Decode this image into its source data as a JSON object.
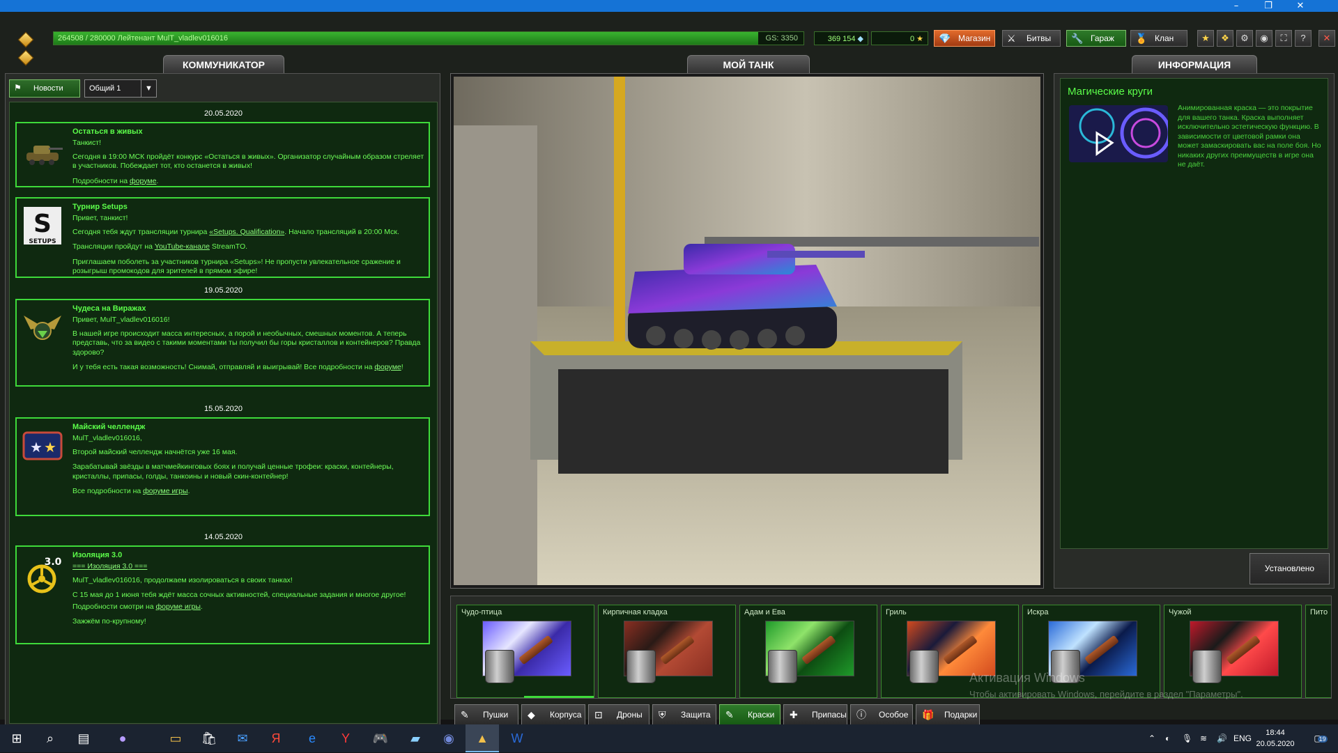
{
  "window": {
    "minimize_icon": "minimize-icon",
    "maximize_icon": "restore-icon",
    "close_icon": "close-icon"
  },
  "topbar": {
    "xp_text": "264508 / 280000  Лейтенант MulT_vladlev016016",
    "xp_progress": 0.94,
    "gs_text": "GS: 3350",
    "crystals": "369 154",
    "stars": "0",
    "buttons": {
      "shop": "Магазин",
      "battles": "Битвы",
      "garage": "Гараж",
      "clan": "Клан"
    },
    "icons": [
      "star-icon",
      "medal-icon",
      "gear-icon",
      "sound-icon",
      "fullscreen-icon",
      "help-icon",
      "exit-icon"
    ]
  },
  "panels": {
    "communicator": "КОММУНИКАТОР",
    "mytank": "МОЙ ТАНК",
    "info": "ИНФОРМАЦИЯ"
  },
  "communicator": {
    "news_button": "Новости",
    "channel": "Общий 1",
    "feed": [
      {
        "date": "20.05.2020"
      },
      {
        "title": "Остаться в живых",
        "lines": [
          "Танкист!",
          "Сегодня в 19:00 МСК пройдёт конкурс «Остаться в живых». Организатор случайным образом стреляет в участников. Побеждает тот, кто останется в живых!"
        ],
        "link_prefix": "Подробности на ",
        "link": "форуме",
        "link_suffix": "."
      },
      {
        "title": "Турнир  Setups",
        "lines": [
          "Привет, танкист!"
        ],
        "p2_prefix": "Сегодня тебя ждут трансляции турнира ",
        "p2_link": "«Setups. Qualification»",
        "p2_suffix": ".  Начало трансляций в 20:00 Мск.",
        "p3_prefix": "Трансляции пройдут на ",
        "p3_link": "YouTube-канале",
        "p3_suffix": "  StreamTO.",
        "p4": "Приглашаем поболеть за участников турнира «Setups»! Не пропусти увлекательное сражение и розыгрыш промокодов для зрителей в прямом эфире!"
      },
      {
        "date": "19.05.2020"
      },
      {
        "title": "Чудеса на Виражах",
        "lines": [
          "Привет, MulT_vladlev016016!",
          "В нашей игре происходит масса интересных, а порой и необычных, смешных моментов. А теперь представь, что за видео с такими моментами ты получил бы горы кристаллов и контейнеров? Правда здорово?"
        ],
        "link_prefix": " И у тебя есть такая возможность! Снимай, отправляй и выигрывай! Все подробности на ",
        "link": "форуме",
        "link_suffix": "!"
      },
      {
        "date": "15.05.2020"
      },
      {
        "title": " Майский челлендж",
        "lines": [
          "MulT_vladlev016016,",
          "Второй майский челлендж начнётся уже 16 мая.",
          "Зарабатывай звёзды в матчмейкинговых боях и получай ценные трофеи: краски, контейнеры, кристаллы, припасы, голды, танкоины и новый скин-контейнер!"
        ],
        "link_prefix": "Все подробности на ",
        "link": "форуме игры",
        "link_suffix": "."
      },
      {
        "date": "14.05.2020"
      },
      {
        "title": "Изоляция 3.0",
        "subtitle_link": "=== Изоляция 3.0 ===",
        "lines": [
          "MulT_vladlev016016, продолжаем изолироваться в своих танках!",
          "С 15 мая до 1 июня тебя ждёт масса сочных активностей, специальные задания и многое другое!"
        ],
        "link_prefix": "Подробности смотри на ",
        "link": "форуме игры",
        "link_suffix": ".",
        "outro": "Зажжём по-крупному!"
      }
    ]
  },
  "info": {
    "title": "Магические круги",
    "description": "Анимированная краска — это покрытие для вашего танка. Краска выполняет исключительно эстетическую функцию. В зависимости от цветовой рамки она может замаскировать вас на поле боя. Но никаких других преимуществ в игре она не даёт.",
    "installed_button": "Установлено"
  },
  "items": [
    {
      "name": "Чудо-птица",
      "colors": [
        "#6a5cff",
        "#e6e6ff",
        "#3a2aa8"
      ]
    },
    {
      "name": "Кирпичная кладка",
      "colors": [
        "#8a2f22",
        "#2a1a16",
        "#b34a34"
      ]
    },
    {
      "name": "Адам и Ева",
      "colors": [
        "#1f9a2a",
        "#8fe36a",
        "#0d4d12"
      ]
    },
    {
      "name": "Гриль",
      "colors": [
        "#d24a1e",
        "#1a1a3a",
        "#ff8a3a"
      ]
    },
    {
      "name": "Искра",
      "colors": [
        "#2a6ad8",
        "#bfe2ff",
        "#0a1a4a"
      ]
    },
    {
      "name": "Чужой",
      "colors": [
        "#c0192a",
        "#1a1a1a",
        "#ff4a4a"
      ]
    },
    {
      "name": "Пито"
    }
  ],
  "categories": [
    "Пушки",
    "Корпуса",
    "Дроны",
    "Защита",
    "Краски",
    "Припасы",
    "Особое",
    "Подарки"
  ],
  "active_category": "Краски",
  "watermark": {
    "line1": "Активация Windows",
    "line2": "Чтобы активировать Windows, перейдите в раздел \"Параметры\"."
  },
  "taskbar": {
    "apps": [
      "start-icon",
      "search-icon",
      "task-view-icon",
      "cortana-icon",
      "file-explorer-icon",
      "store-icon",
      "mail-icon",
      "yandex-icon",
      "edge-icon",
      "yandex-browser-icon",
      "game-icon",
      "tablet-icon",
      "discord-icon",
      "tanki-icon",
      "word-icon"
    ],
    "lang": "ENG",
    "time": "18:44",
    "date": "20.05.2020",
    "notifications": "19"
  }
}
